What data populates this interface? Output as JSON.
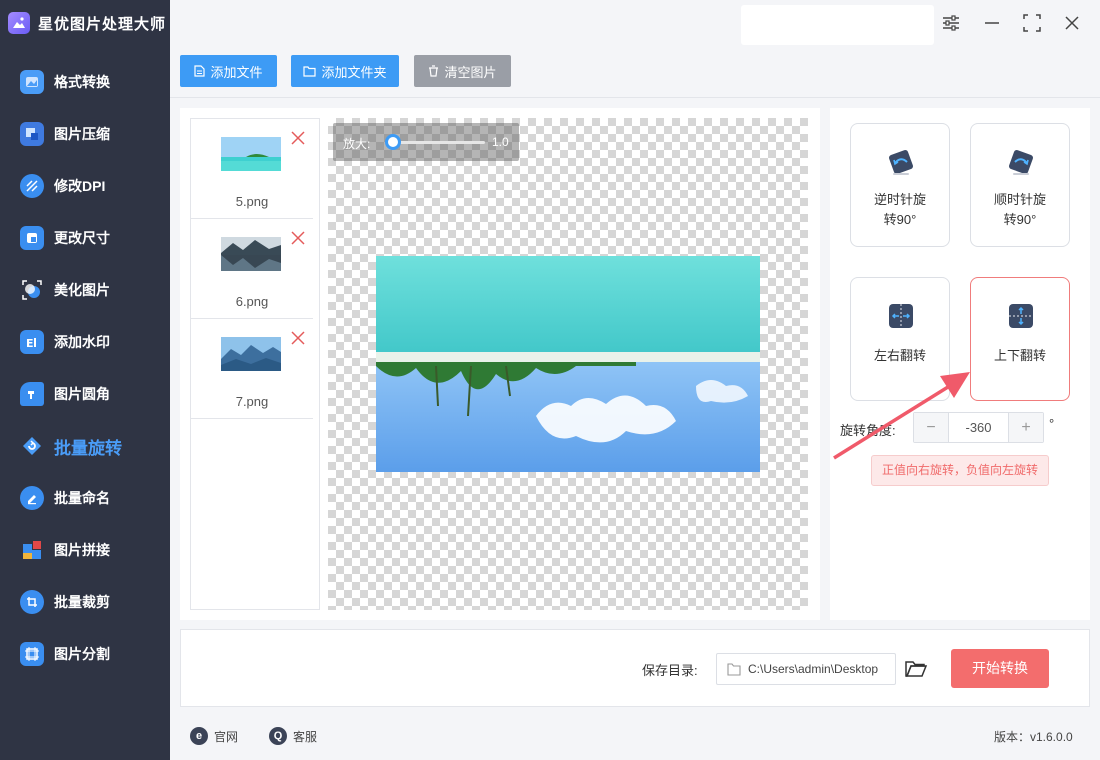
{
  "app": {
    "title": "星优图片处理大师",
    "version": "版本：v1.6.0.0"
  },
  "sidebar": {
    "items": [
      {
        "label": "格式转换",
        "icon": "format-convert-icon"
      },
      {
        "label": "图片压缩",
        "icon": "image-compress-icon"
      },
      {
        "label": "修改DPI",
        "icon": "dpi-icon"
      },
      {
        "label": "更改尺寸",
        "icon": "resize-icon"
      },
      {
        "label": "美化图片",
        "icon": "beautify-icon"
      },
      {
        "label": "添加水印",
        "icon": "watermark-icon"
      },
      {
        "label": "图片圆角",
        "icon": "round-corner-icon"
      },
      {
        "label": "批量旋转",
        "icon": "batch-rotate-icon"
      },
      {
        "label": "批量命名",
        "icon": "batch-rename-icon"
      },
      {
        "label": "图片拼接",
        "icon": "image-stitch-icon"
      },
      {
        "label": "批量裁剪",
        "icon": "batch-crop-icon"
      },
      {
        "label": "图片分割",
        "icon": "image-split-icon"
      }
    ],
    "active_index": 7
  },
  "toolbar": {
    "add_file": "添加文件",
    "add_folder": "添加文件夹",
    "clear": "清空图片"
  },
  "files": [
    {
      "name": "5.png"
    },
    {
      "name": "6.png"
    },
    {
      "name": "7.png"
    }
  ],
  "preview": {
    "zoom_label": "放大:",
    "zoom_value": "1.0",
    "zoom_level": 1.0
  },
  "operations": {
    "ccw": "逆时针旋\n转90°",
    "cw": "顺时针旋\n转90°",
    "flip_h": "左右翻转",
    "flip_v": "上下翻转",
    "selected": "flip_v"
  },
  "rotation": {
    "label": "旋转角度:",
    "value": "-360",
    "minus": "−",
    "plus": "+",
    "unit": "°",
    "hint": "正值向右旋转，负值向左旋转"
  },
  "output": {
    "save_label": "保存目录:",
    "path": "C:\\Users\\admin\\Desktop",
    "start": "开始转换"
  },
  "footer": {
    "website": "官网",
    "support": "客服"
  },
  "colors": {
    "sidebar_bg": "#2f3444",
    "accent": "#3d9bf5",
    "start": "#f36d6d",
    "active_nav": "#4a9cf7"
  }
}
